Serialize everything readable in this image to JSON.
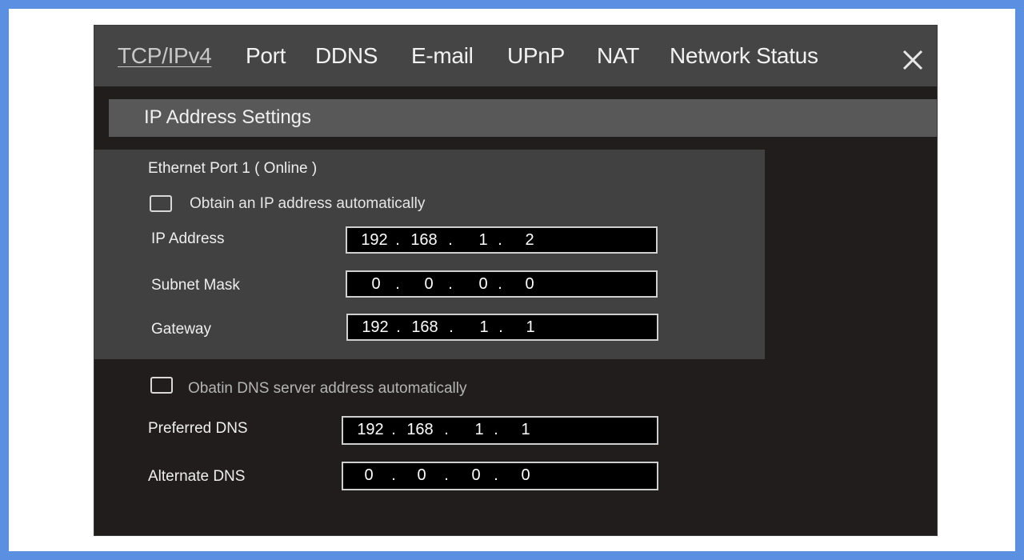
{
  "tabs": [
    {
      "label": "TCP/IPv4",
      "active": true
    },
    {
      "label": "Port"
    },
    {
      "label": "DDNS"
    },
    {
      "label": "E-mail"
    },
    {
      "label": "UPnP"
    },
    {
      "label": "NAT"
    },
    {
      "label": "Network Status"
    }
  ],
  "close_icon": "close-icon",
  "section": {
    "title": "IP Address Settings"
  },
  "ethernet": {
    "port_label": "Ethernet Port 1 ( Online )",
    "auto_ip_label": "Obtain an IP address automatically",
    "auto_ip_checked": false,
    "fields": [
      {
        "label": "IP Address",
        "octets": [
          "192",
          "168",
          "1",
          "2"
        ]
      },
      {
        "label": "Subnet Mask",
        "octets": [
          "0",
          "0",
          "0",
          "0"
        ]
      },
      {
        "label": "Gateway",
        "octets": [
          "192",
          "168",
          "1",
          "1"
        ]
      }
    ]
  },
  "dns": {
    "auto_dns_label": "Obatin DNS server address automatically",
    "auto_dns_checked": false,
    "fields": [
      {
        "label": "Preferred DNS",
        "octets": [
          "192",
          "168",
          "1",
          "1"
        ]
      },
      {
        "label": "Alternate DNS",
        "octets": [
          "0",
          "0",
          "0",
          "0"
        ]
      }
    ]
  },
  "colors": {
    "window_bg": "#211d1d",
    "tabbar_bg": "#454545",
    "section_bg": "#585858",
    "panel_bg": "#414141",
    "frame": "#5b8fe2"
  }
}
